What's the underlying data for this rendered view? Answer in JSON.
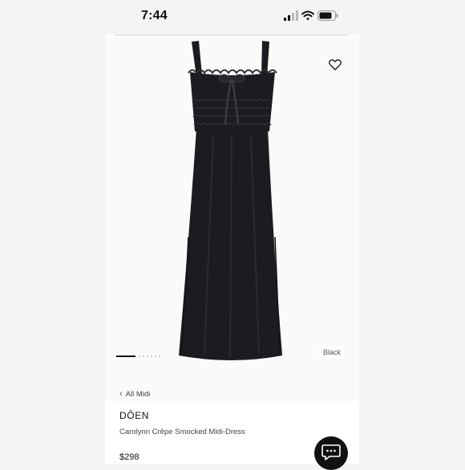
{
  "status_bar": {
    "time": "7:44",
    "icons": [
      "signal-icon",
      "wifi-icon",
      "battery-icon"
    ]
  },
  "product": {
    "image_subject": "black smocked midi dress",
    "color_label": "Black",
    "gallery": {
      "current_index": 1,
      "total_images": 7
    },
    "breadcrumb_label": "All Midi",
    "brand": "DÔEN",
    "name": "Carolynn Crêpe Smocked Midi-Dress",
    "price": "$298"
  },
  "actions": {
    "wishlist_icon": "heart-outline-icon",
    "chat_icon": "chat-bubble-icon"
  },
  "colors": {
    "background": "#f4f4f4",
    "card": "#ffffff",
    "dress": "#1c1c20",
    "chat_button": "#111111"
  }
}
